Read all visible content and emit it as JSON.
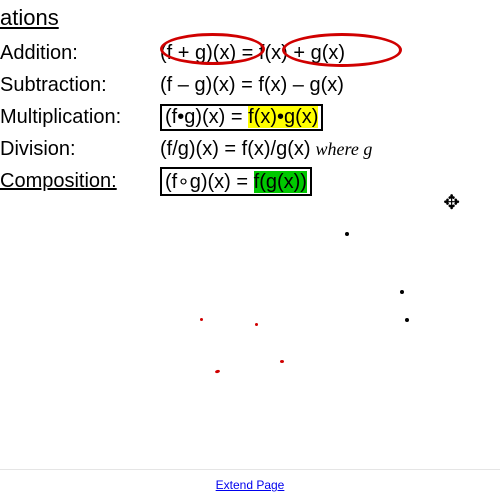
{
  "heading": "ations",
  "rows": {
    "addition": {
      "label": "Addition:",
      "lhs": "(f + g)(x) ",
      "eq": "=",
      "rhs": " f(x) + g(x)"
    },
    "subtraction": {
      "label": "Subtraction:",
      "formula": "(f – g)(x) = f(x) – g(x)"
    },
    "multiplication": {
      "label": "Multiplication:",
      "lhs": "(f•g)(x) = ",
      "hl": "f(x)•g(x)"
    },
    "division": {
      "label": "Division:",
      "formula": "(f/g)(x) = f(x)/g(x)",
      "note": "where g"
    },
    "composition": {
      "label": "Composition:",
      "lhs": "(f∘g)(x) = ",
      "hl": "f(g(x))"
    }
  },
  "footer": {
    "link": "Extend Page"
  },
  "cursor_icon": "✥"
}
